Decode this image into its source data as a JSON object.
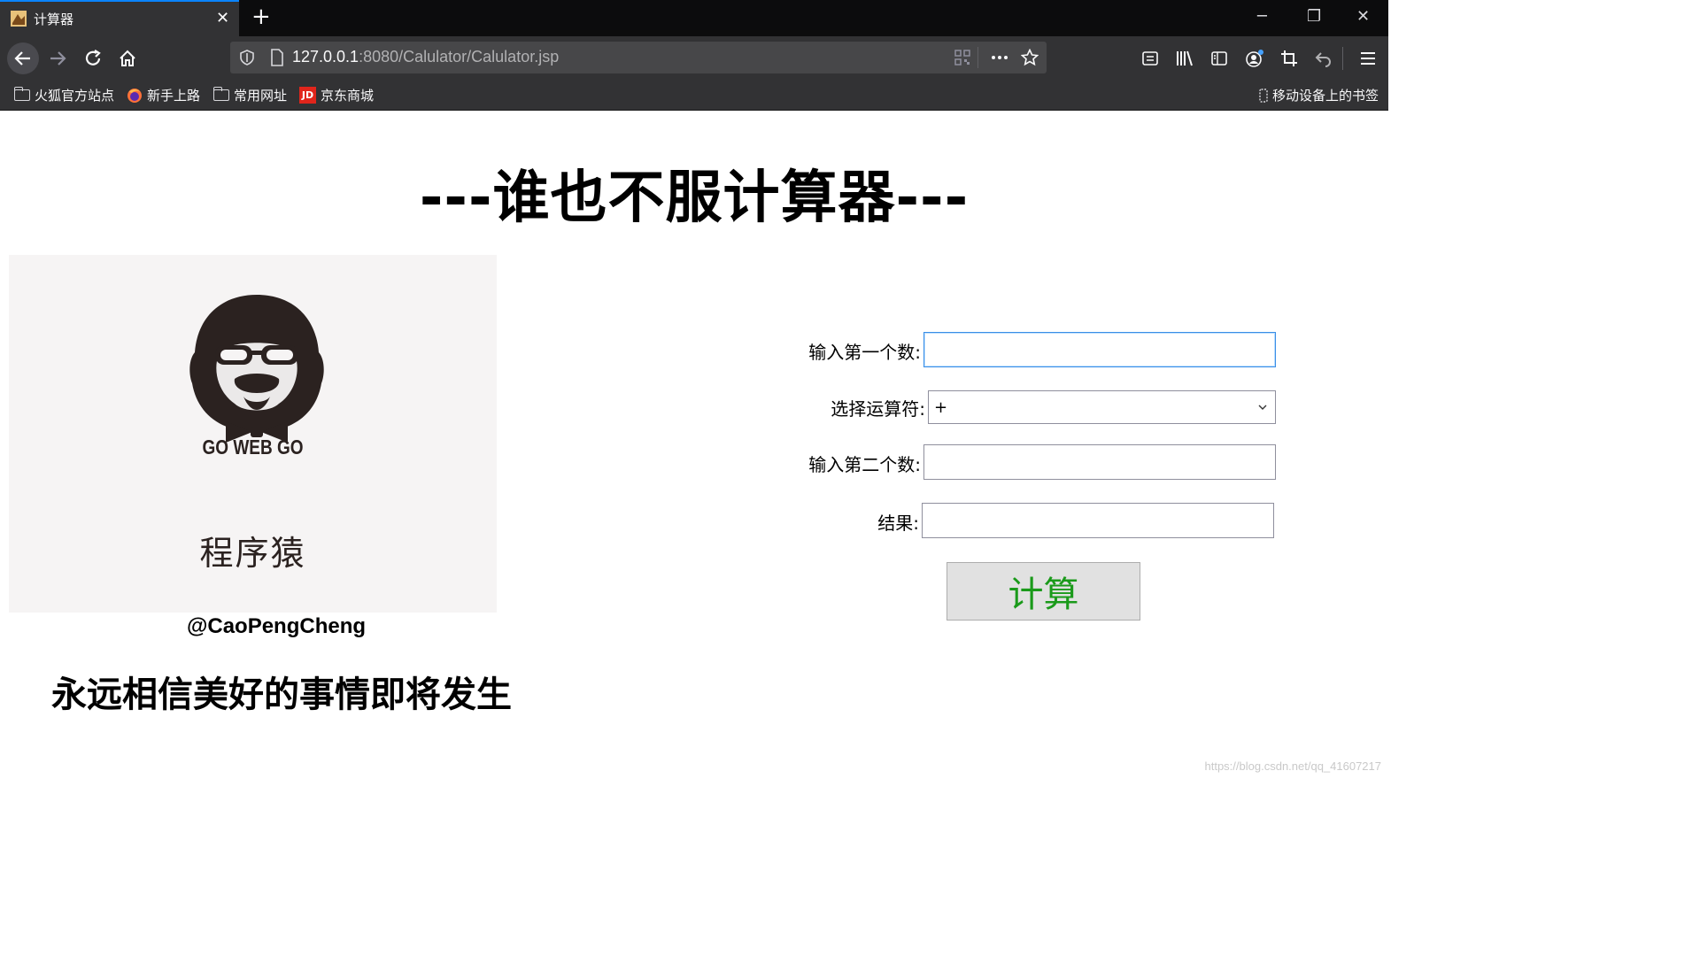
{
  "browser": {
    "tab_title": "计算器",
    "tab_close": "✕",
    "new_tab": "+",
    "window": {
      "minimize": "─",
      "restore": "❐",
      "close": "✕"
    },
    "url_host": "127.0.0.1",
    "url_rest": ":8080/Calulator/Calulator.jsp",
    "bookmarks": [
      {
        "label": "火狐官方站点",
        "icon": "folder-icon"
      },
      {
        "label": "新手上路",
        "icon": "firefox-icon"
      },
      {
        "label": "常用网址",
        "icon": "folder-icon"
      },
      {
        "label": "京东商城",
        "icon": "jd-icon"
      }
    ],
    "jd_badge": "JD",
    "mobile_bookmarks": "移动设备上的书签"
  },
  "page": {
    "title": "---谁也不服计算器---",
    "logo": {
      "brand": "GO WEB GO",
      "caption": "程序猿"
    },
    "author": "@CaoPengCheng",
    "motto": "永远相信美好的事情即将发生",
    "form": {
      "first_label": "输入第一个数:",
      "first_value": "",
      "operator_label": "选择运算符:",
      "operator_value": "+",
      "second_label": "输入第二个数:",
      "second_value": "",
      "result_label": "结果:",
      "result_value": "",
      "submit_label": "计算"
    },
    "watermark": "https://blog.csdn.net/qq_41607217"
  },
  "colors": {
    "tab_accent": "#0a84ff",
    "button_text": "#1a9a1a",
    "focus_border": "#3a8ee6"
  }
}
